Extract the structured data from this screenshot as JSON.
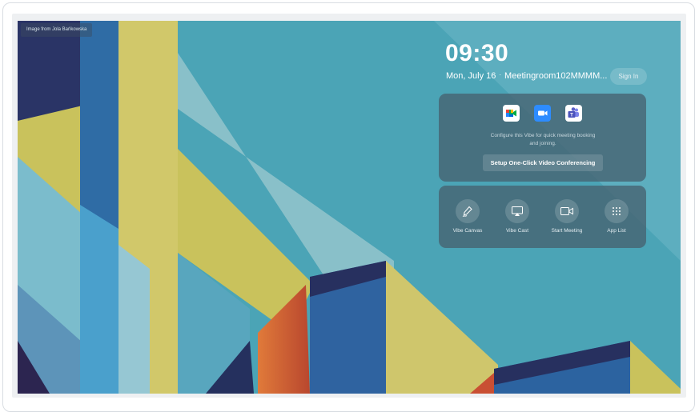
{
  "wallpaper": {
    "credit": "Image from Jola Bańkowska"
  },
  "clock": {
    "time": "09:30",
    "date": "Mon, July 16",
    "separator": "·",
    "room": "Meetingroom102MMMM..."
  },
  "header": {
    "sign_in_label": "Sign In"
  },
  "conferencing": {
    "apps": [
      {
        "icon": "google-meet-icon",
        "color": "#00a85a"
      },
      {
        "icon": "zoom-icon",
        "color": "#2d8cff"
      },
      {
        "icon": "teams-icon",
        "color": "#5b5fc7"
      }
    ],
    "description_line1": "Configure this Vibe for quick meeting booking",
    "description_line2": "and joining.",
    "setup_label": "Setup One-Click Video Conferencing"
  },
  "tools": [
    {
      "label": "Vibe Canvas",
      "icon": "vibe-canvas-icon"
    },
    {
      "label": "Vibe Cast",
      "icon": "vibe-cast-icon"
    },
    {
      "label": "Start Meeting",
      "icon": "video-camera-icon"
    },
    {
      "label": "App List",
      "icon": "app-grid-icon"
    }
  ]
}
